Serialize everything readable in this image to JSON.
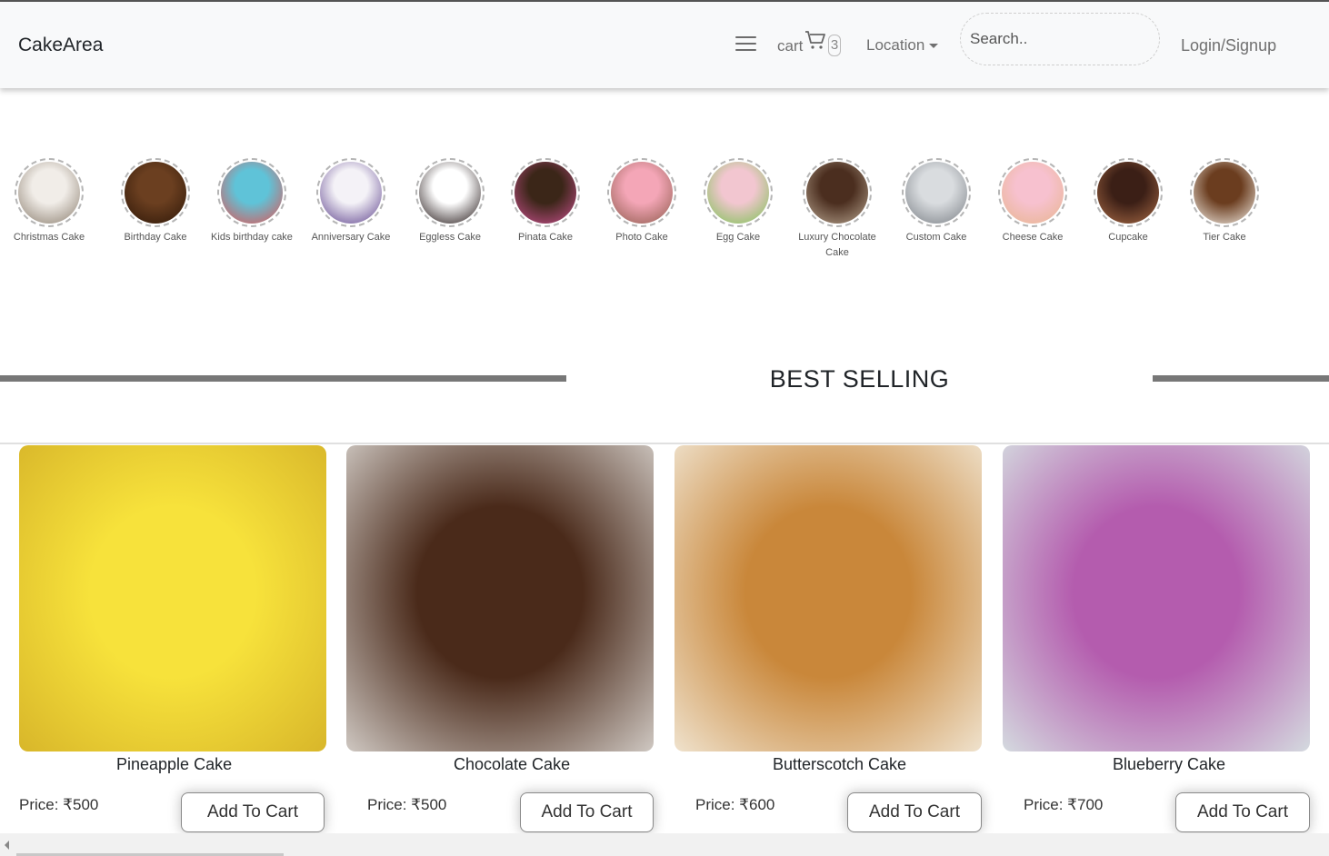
{
  "navbar": {
    "brand": "CakeArea",
    "cart_label": "cart",
    "cart_count": "3",
    "location_label": "Location",
    "search_placeholder": "Search..",
    "login_label": "Login/Signup"
  },
  "categories": [
    {
      "label": "Christmas Cake",
      "colors": [
        "#f1ede8",
        "#8a7d6e"
      ]
    },
    {
      "label": "Birthday Cake",
      "colors": [
        "#6b3f20",
        "#2d1708"
      ]
    },
    {
      "label": "Kids birthday cake",
      "colors": [
        "#5fc3d8",
        "#e6504f"
      ]
    },
    {
      "label": "Anniversary Cake",
      "colors": [
        "#f4f2f7",
        "#5b3f8b"
      ]
    },
    {
      "label": "Eggless Cake",
      "colors": [
        "#ffffff",
        "#1e1212"
      ]
    },
    {
      "label": "Pinata Cake",
      "colors": [
        "#3b2618",
        "#c94f8e"
      ]
    },
    {
      "label": "Photo Cake",
      "colors": [
        "#f4a6b7",
        "#8d5a4a"
      ]
    },
    {
      "label": "Egg Cake",
      "colors": [
        "#f2c6d0",
        "#7ac251"
      ]
    },
    {
      "label": "Luxury Chocolate Cake",
      "colors": [
        "#4b2e1f",
        "#b7a48f"
      ]
    },
    {
      "label": "Custom Cake",
      "colors": [
        "#d9dcdf",
        "#7a7f85"
      ]
    },
    {
      "label": "Cheese Cake",
      "colors": [
        "#f7c1cf",
        "#e7b58d"
      ]
    },
    {
      "label": "Cupcake",
      "colors": [
        "#3b1f16",
        "#a86a45"
      ]
    },
    {
      "label": "Tier Cake",
      "colors": [
        "#6b3d1f",
        "#f4efe7"
      ]
    }
  ],
  "section": {
    "title": "BEST SELLING"
  },
  "products": [
    {
      "name": "Pineapple Cake",
      "price": "Price: ₹500",
      "button": "Add To Cart",
      "colors": [
        "#f7e23b",
        "#d8b62a"
      ]
    },
    {
      "name": "Chocolate Cake",
      "price": "Price: ₹500",
      "button": "Add To Cart",
      "colors": [
        "#4a2a1a",
        "#cfc8c2"
      ]
    },
    {
      "name": "Butterscotch Cake",
      "price": "Price: ₹600",
      "button": "Add To Cart",
      "colors": [
        "#c9873a",
        "#efe2cd"
      ]
    },
    {
      "name": "Blueberry Cake",
      "price": "Price: ₹700",
      "button": "Add To Cart",
      "colors": [
        "#b45cae",
        "#d4dadf"
      ]
    }
  ]
}
